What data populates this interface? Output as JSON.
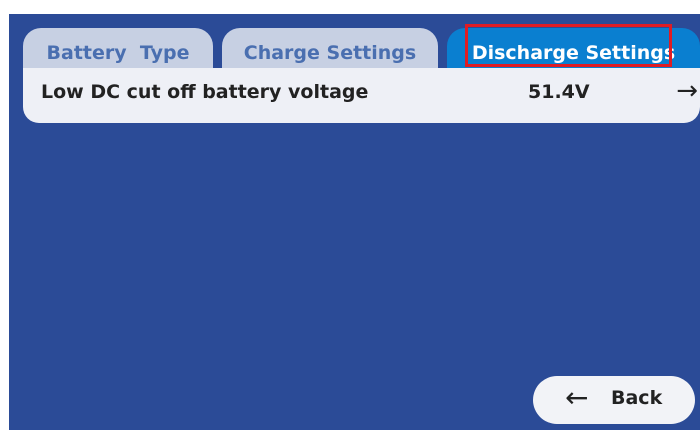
{
  "tabs": [
    {
      "label": "Battery  Type",
      "active": false
    },
    {
      "label": "Charge Settings",
      "active": false
    },
    {
      "label": "Discharge Settings",
      "active": true
    }
  ],
  "setting_row": {
    "label": "Low DC cut off battery voltage",
    "value": "51.4V",
    "arrow_icon": "→"
  },
  "back_button": {
    "icon": "←",
    "label": "Back"
  },
  "colors": {
    "screen_background": "#2b4b97",
    "tab_inactive": "#c7d0e3",
    "tab_inactive_text": "#4a6fb0",
    "tab_active": "#0a7fd0",
    "highlight_border": "#e01c24",
    "row_background": "#eef0f6"
  }
}
